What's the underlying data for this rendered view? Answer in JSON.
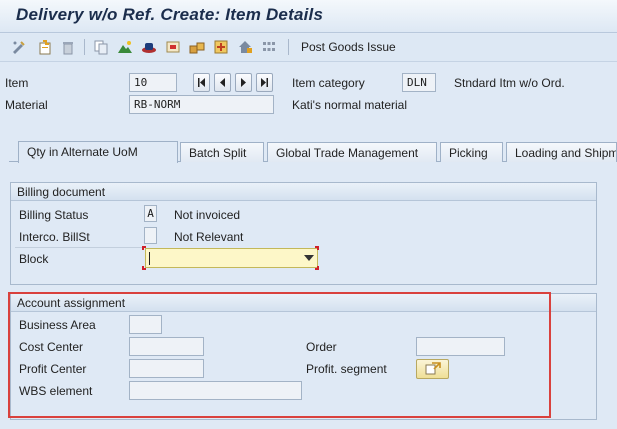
{
  "window": {
    "title": "Delivery w/o Ref.  Create: Item Details"
  },
  "toolbar": {
    "icons": [
      "change-display-icon",
      "create-icon",
      "delete-icon",
      "copy-icon",
      "landscape-icon",
      "hat-icon",
      "pick-icon",
      "packages-icon",
      "pack-icon",
      "home-icon",
      "grid-icon"
    ],
    "post_goods_issue": "Post Goods Issue"
  },
  "header": {
    "item_label": "Item",
    "item_value": "10",
    "item_category_label": "Item category",
    "item_category_value": "DLN",
    "item_category_text": "Stndard Itm w/o Ord.",
    "material_label": "Material",
    "material_value": "RB-NORM",
    "material_text": "Kati's normal material"
  },
  "tabs": [
    {
      "label": "Qty in Alternate UoM"
    },
    {
      "label": "Batch Split"
    },
    {
      "label": "Global Trade Management"
    },
    {
      "label": "Picking"
    },
    {
      "label": "Loading and Shipm"
    }
  ],
  "billing": {
    "title": "Billing document",
    "status_label": "Billing Status",
    "status_value": "A",
    "status_text": "Not invoiced",
    "interco_label": "Interco. BillSt",
    "interco_value": "",
    "interco_text": "Not Relevant",
    "block_label": "Block",
    "block_value": ""
  },
  "account": {
    "title": "Account assignment",
    "business_area_label": "Business Area",
    "business_area_value": "",
    "cost_center_label": "Cost Center",
    "cost_center_value": "",
    "order_label": "Order",
    "order_value": "",
    "profit_center_label": "Profit Center",
    "profit_center_value": "",
    "profit_segment_label": "Profit. segment",
    "wbs_label": "WBS element",
    "wbs_value": ""
  },
  "colors": {
    "highlight": "#d9413d",
    "title": "#1b2d4c",
    "dropdown_bg": "#fdf7c8"
  }
}
